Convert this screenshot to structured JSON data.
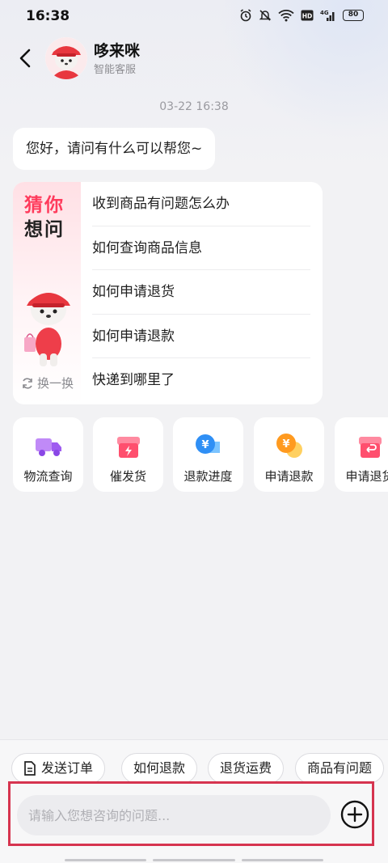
{
  "status_bar": {
    "time": "16:38",
    "battery": "80",
    "icons": [
      "alarm-icon",
      "mute-icon",
      "wifi-icon",
      "hd-icon",
      "signal-4g-icon",
      "battery-icon"
    ]
  },
  "header": {
    "back_icon": "chevron-left-icon",
    "agent_name": "哆来咪",
    "agent_subtitle": "智能客服"
  },
  "chat": {
    "timestamp": "03-22 16:38",
    "greeting": "您好，请问有什么可以帮您~"
  },
  "guess_card": {
    "title_line1": "猜你",
    "title_line2": "想问",
    "refresh_label": "换一换",
    "questions": [
      "收到商品有问题怎么办",
      "如何查询商品信息",
      "如何申请退货",
      "如何申请退款",
      "快递到哪里了"
    ]
  },
  "quick_actions": [
    {
      "label": "物流查询",
      "icon": "truck-icon",
      "color": "#b06bf5"
    },
    {
      "label": "催发货",
      "icon": "package-bolt-icon",
      "color": "#ff4f6e"
    },
    {
      "label": "退款进度",
      "icon": "yen-chat-icon",
      "color": "#2f8ff5"
    },
    {
      "label": "申请退款",
      "icon": "yen-coin-chat-icon",
      "color": "#ff9a1f"
    },
    {
      "label": "申请退货",
      "icon": "return-box-icon",
      "color": "#ff4f6e"
    }
  ],
  "suggestion_chips": [
    {
      "label": "发送订单",
      "icon": "document-icon"
    },
    {
      "label": "如何退款"
    },
    {
      "label": "退货运费"
    },
    {
      "label": "商品有问题"
    }
  ],
  "input": {
    "placeholder": "请输入您想咨询的问题...",
    "plus_icon": "plus-circle-icon"
  },
  "colors": {
    "accent_red": "#ff3b5c",
    "highlight_frame": "#d6344f",
    "background": "#f2f2f4"
  }
}
